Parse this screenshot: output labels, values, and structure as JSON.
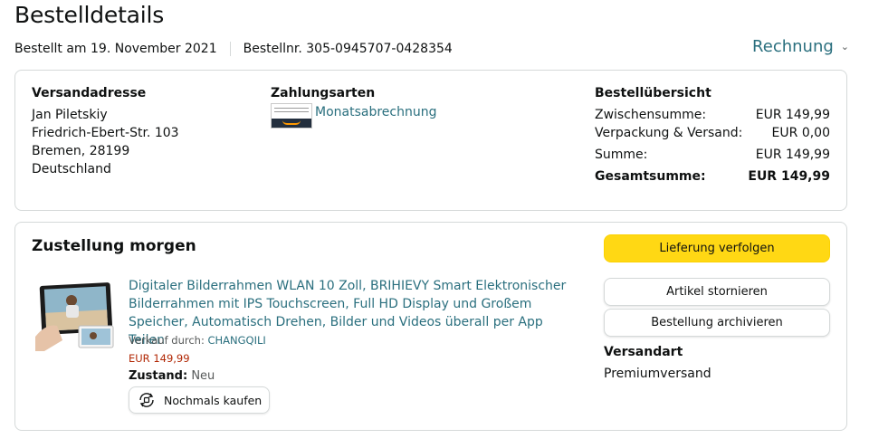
{
  "header": {
    "title": "Bestelldetails",
    "order_date": "Bestellt am 19. November 2021",
    "order_number": "Bestellnr. 305-0945707-0428354",
    "invoice_label": "Rechnung"
  },
  "summary_box": {
    "shipping": {
      "title": "Versandadresse",
      "lines": [
        "Jan Piletskiy",
        "Friedrich-Ebert-Str. 103",
        "Bremen, 28199",
        "Deutschland"
      ]
    },
    "payment": {
      "title": "Zahlungsarten",
      "method": "Monatsabrechnung"
    },
    "overview": {
      "title": "Bestellübersicht",
      "rows": [
        {
          "label": "Zwischensumme:",
          "value": "EUR 149,99"
        },
        {
          "label": "Verpackung & Versand:",
          "value": "EUR 0,00"
        },
        {
          "label": "Summe:",
          "value": "EUR 149,99"
        },
        {
          "label": "Gesamtsumme:",
          "value": "EUR 149,99"
        }
      ]
    }
  },
  "delivery": {
    "title": "Zustellung morgen",
    "product": {
      "title": "Digitaler Bilderrahmen WLAN 10 Zoll, BRIHIEVY Smart Elektronischer Bilderrahmen mit IPS Touchscreen, Full HD Display und Großem Speicher, Automatisch Drehen, Bilder und Videos überall per App Teilen",
      "seller_prefix": "Verkauf durch:",
      "seller_name": "CHANGQILI",
      "price": "EUR 149,99",
      "condition_label": "Zustand:",
      "condition_value": "Neu",
      "rebuy_label": "Nochmals kaufen"
    },
    "buttons": {
      "track": "Lieferung verfolgen",
      "cancel": "Artikel stornieren",
      "archive": "Bestellung archivieren"
    },
    "shipping_method": {
      "label": "Versandart",
      "value": "Premiumversand"
    }
  },
  "colors": {
    "link": "#2a6f7e",
    "price": "#b12704",
    "primary_button": "#ffd814",
    "border": "#d5d9d9"
  },
  "icons": [
    "chevron-down-icon",
    "payment-card-icon",
    "rebuy-icon"
  ]
}
